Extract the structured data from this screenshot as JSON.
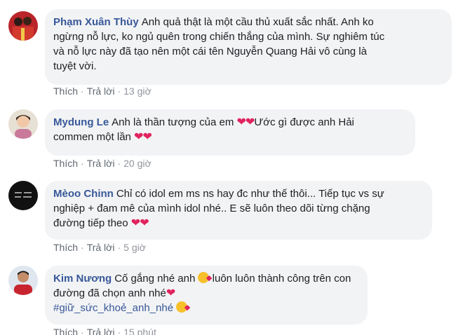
{
  "comments": [
    {
      "author": "Phạm Xuân Thùy",
      "lines": [
        "Anh quả thật là một cầu thủ xuất sắc nhất. Anh ko",
        "ngừng nỗ lực, ko ngủ quên trong chiến thắng của mình. Sự nghiêm túc",
        "và nỗ lực này đã tạo nên một cái tên Nguyễn Quang Hải vô cùng là",
        "tuyệt vời."
      ],
      "like": "Thích",
      "reply": "Trả lời",
      "time": "13 giờ"
    },
    {
      "author": "Mydung Le",
      "lines": [
        "Anh là thần tượng của em",
        "Ước gì được anh Hải",
        "commen một lần"
      ],
      "like": "Thích",
      "reply": "Trả lời",
      "time": "20 giờ"
    },
    {
      "author": "Mèoo Chinn",
      "lines": [
        "Chỉ có idol em ms ns hay đc như thế thôi... Tiếp tục vs sự",
        "nghiệp + đam mê của mình idol nhé.. E sẽ luôn theo dõi từng chặng",
        "đường tiếp theo"
      ],
      "like": "Thích",
      "reply": "Trả lời",
      "time": "5 giờ"
    },
    {
      "author": "Kim Nương",
      "lines": [
        "Cố gắng nhé anh",
        "luôn luôn thành công trên con",
        "đường đã chọn anh nhé",
        "#giữ_sức_khoẻ_anh_nhé"
      ],
      "like": "Thích",
      "reply": "Trả lời",
      "time": "15 phút"
    }
  ],
  "separator": "·",
  "heart_glyph": "❤",
  "colors": {
    "author": "#385898",
    "bubble": "#f2f3f5",
    "meta": "#90949c",
    "heart": "#e0245e"
  }
}
